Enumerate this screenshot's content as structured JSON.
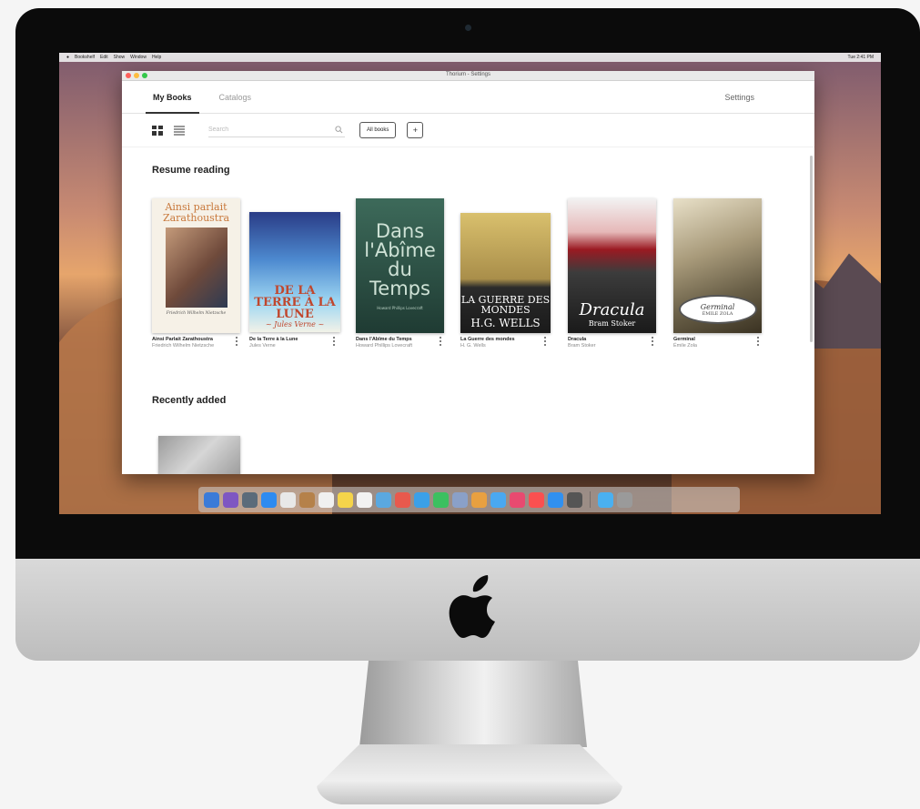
{
  "menubar": {
    "items": [
      "Bookshelf",
      "Edit",
      "Show",
      "Window",
      "Help"
    ],
    "status": "Tue 2:41 PM"
  },
  "window": {
    "title": "Thorium - Settings"
  },
  "tabs": {
    "my_books": "My Books",
    "catalogs": "Catalogs",
    "settings": "Settings"
  },
  "toolbar": {
    "search_placeholder": "Search",
    "filter_label": "All books",
    "add_label": "+"
  },
  "sections": {
    "resume_reading": "Resume reading",
    "recently_added": "Recently added"
  },
  "books": [
    {
      "cover_title": "Ainsi parlait Zarathoustra",
      "cover_author": "Friedrich Wilhelm Nietzsche",
      "title": "Ainsi Parlait Zarathoustra",
      "author": "Friedrich Wilhelm Nietzsche"
    },
    {
      "cover_title": "DE LA TERRE À LA LUNE",
      "cover_author": "~ Jules Verne ~",
      "title": "De la Terre à la Lune",
      "author": "Jules Verne"
    },
    {
      "cover_title": "Dans l'Abîme du Temps",
      "cover_author": "Howard Phillips Lovecraft",
      "title": "Dans l'Abîme du Temps",
      "author": "Howard Phillips Lovecraft"
    },
    {
      "cover_title": "LA GUERRE DES MONDES",
      "cover_author": "H.G. WELLS",
      "title": "La Guerre des mondes",
      "author": "H. G. Wells"
    },
    {
      "cover_title": "Dracula",
      "cover_author": "Bram Stoker",
      "title": "Dracula",
      "author": "Bram Stoker"
    },
    {
      "cover_title": "Germinal",
      "cover_author": "ÉMILE ZOLA",
      "title": "Germinal",
      "author": "Émile Zola"
    }
  ],
  "dock_colors": [
    "#3b7bd8",
    "#7e57c2",
    "#5b6b7a",
    "#2e8bf0",
    "#e8e8e8",
    "#b5814a",
    "#f0f0f0",
    "#f5d44a",
    "#f2f2f2",
    "#5aa8e0",
    "#e8594d",
    "#3ba0e8",
    "#3cc060",
    "#8aa0c8",
    "#e8a040",
    "#4aa8f0",
    "#e84a70",
    "#fa5050",
    "#3090f0",
    "#555555",
    "#4ab0f0",
    "#9a9a9a"
  ],
  "colors": {
    "accent": "#333333",
    "window_bg": "#ffffff",
    "bezel": "#0b0b0b"
  }
}
